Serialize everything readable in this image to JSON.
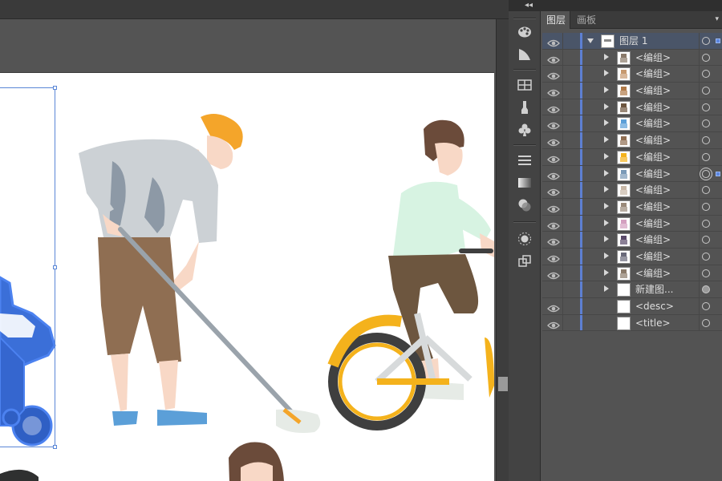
{
  "panel": {
    "tabs": [
      {
        "label": "图层",
        "active": true
      },
      {
        "label": "画板",
        "active": false
      }
    ]
  },
  "layers": [
    {
      "name": "图层 1",
      "level": 0,
      "expanded": true,
      "visible": true,
      "selected": true,
      "target": "empty",
      "sel_square": true
    },
    {
      "name": "<编组>",
      "level": 1,
      "expanded": false,
      "visible": true,
      "selected": false,
      "target": "empty",
      "sel_square": false
    },
    {
      "name": "<编组>",
      "level": 1,
      "expanded": false,
      "visible": true,
      "selected": false,
      "target": "empty",
      "sel_square": false
    },
    {
      "name": "<编组>",
      "level": 1,
      "expanded": false,
      "visible": true,
      "selected": false,
      "target": "empty",
      "sel_square": false
    },
    {
      "name": "<编组>",
      "level": 1,
      "expanded": false,
      "visible": true,
      "selected": false,
      "target": "empty",
      "sel_square": false
    },
    {
      "name": "<编组>",
      "level": 1,
      "expanded": false,
      "visible": true,
      "selected": false,
      "target": "empty",
      "sel_square": false
    },
    {
      "name": "<编组>",
      "level": 1,
      "expanded": false,
      "visible": true,
      "selected": false,
      "target": "empty",
      "sel_square": false
    },
    {
      "name": "<编组>",
      "level": 1,
      "expanded": false,
      "visible": true,
      "selected": false,
      "target": "empty",
      "sel_square": false
    },
    {
      "name": "<编组>",
      "level": 1,
      "expanded": false,
      "visible": true,
      "selected": false,
      "target": "double",
      "sel_square": true
    },
    {
      "name": "<编组>",
      "level": 1,
      "expanded": false,
      "visible": true,
      "selected": false,
      "target": "empty",
      "sel_square": false
    },
    {
      "name": "<编组>",
      "level": 1,
      "expanded": false,
      "visible": true,
      "selected": false,
      "target": "empty",
      "sel_square": false
    },
    {
      "name": "<编组>",
      "level": 1,
      "expanded": false,
      "visible": true,
      "selected": false,
      "target": "empty",
      "sel_square": false
    },
    {
      "name": "<编组>",
      "level": 1,
      "expanded": false,
      "visible": true,
      "selected": false,
      "target": "empty",
      "sel_square": false
    },
    {
      "name": "<编组>",
      "level": 1,
      "expanded": false,
      "visible": true,
      "selected": false,
      "target": "empty",
      "sel_square": false
    },
    {
      "name": "<编组>",
      "level": 1,
      "expanded": false,
      "visible": true,
      "selected": false,
      "target": "empty",
      "sel_square": false
    },
    {
      "name": "新建图...",
      "level": 1,
      "expanded": false,
      "visible": false,
      "selected": false,
      "target": "filled",
      "sel_square": false
    },
    {
      "name": "<desc>",
      "level": 1,
      "expanded": null,
      "visible": true,
      "selected": false,
      "target": "empty",
      "sel_square": false
    },
    {
      "name": "<title>",
      "level": 1,
      "expanded": null,
      "visible": true,
      "selected": false,
      "target": "empty",
      "sel_square": false
    }
  ],
  "toolbar_icons": [
    "palette-icon",
    "gradient-swatch-icon",
    "grid-icon",
    "brush-icon",
    "club-symbol-icon",
    "stroke-lines-icon",
    "gradient-icon",
    "transparency-icon",
    "appearance-sun-icon",
    "layers-arrange-icon"
  ],
  "colors": {
    "layer_color": "#5d7fd2",
    "selection": "#5a86d6",
    "panel_bg": "#535353"
  }
}
